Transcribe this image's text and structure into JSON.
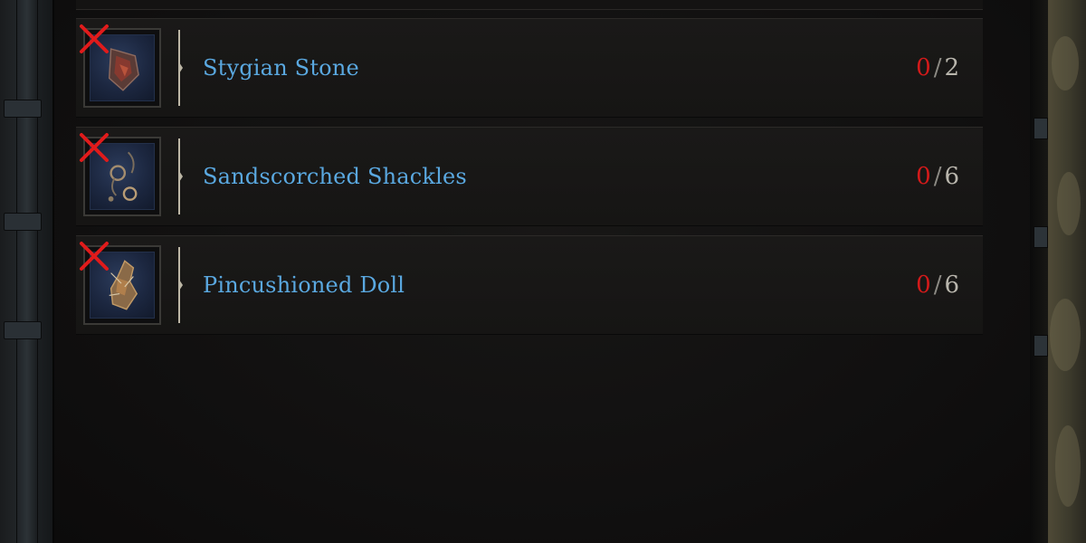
{
  "materials": [
    {
      "name": "Stygian Stone",
      "have": "0",
      "need": "2",
      "icon": "stygian-stone-icon",
      "missing_icon": "red-x-icon"
    },
    {
      "name": "Sandscorched Shackles",
      "have": "0",
      "need": "6",
      "icon": "shackles-icon",
      "missing_icon": "red-x-icon"
    },
    {
      "name": "Pincushioned Doll",
      "have": "0",
      "need": "6",
      "icon": "doll-icon",
      "missing_icon": "red-x-icon"
    }
  ],
  "colors": {
    "item_name": "#5aa8e0",
    "missing_count": "#d31a1a",
    "required_count": "#b9b6ad",
    "missing_mark": "#e01b1b"
  }
}
